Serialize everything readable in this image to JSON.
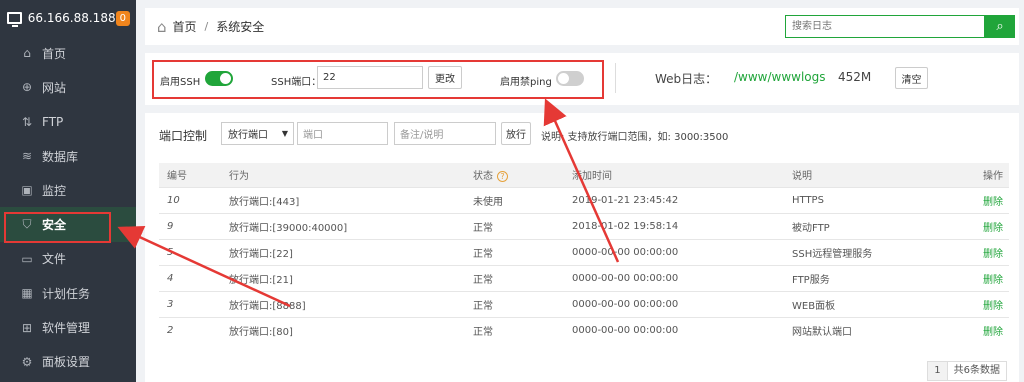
{
  "server": {
    "ip": "66.166.88.188",
    "badge": "0"
  },
  "sidebar": {
    "items": [
      {
        "label": "首页",
        "icon": "home-icon",
        "glyph": "⌂"
      },
      {
        "label": "网站",
        "icon": "globe-icon",
        "glyph": "⊕"
      },
      {
        "label": "FTP",
        "icon": "ftp-icon",
        "glyph": "⇅"
      },
      {
        "label": "数据库",
        "icon": "database-icon",
        "glyph": "≋"
      },
      {
        "label": "监控",
        "icon": "monitor-icon",
        "glyph": "▣"
      },
      {
        "label": "安全",
        "icon": "shield-icon",
        "glyph": "⛉"
      },
      {
        "label": "文件",
        "icon": "folder-icon",
        "glyph": "▭"
      },
      {
        "label": "计划任务",
        "icon": "calendar-icon",
        "glyph": "▦"
      },
      {
        "label": "软件管理",
        "icon": "apps-icon",
        "glyph": "⊞"
      },
      {
        "label": "面板设置",
        "icon": "gear-icon",
        "glyph": "⚙"
      }
    ],
    "active_index": 5
  },
  "breadcrumb": {
    "home": "首页",
    "separator": "/",
    "current": "系统安全"
  },
  "search": {
    "placeholder": "搜索日志",
    "icon": "search-icon"
  },
  "ssh": {
    "enable_label": "启用SSH",
    "enabled": true,
    "port_label": "SSH端口：",
    "port_value": "22",
    "change_button": "更改",
    "ping_label": "启用禁ping",
    "ping_enabled": false
  },
  "weblog": {
    "label": "Web日志：",
    "path": "/www/wwwlogs",
    "size": "452M",
    "clear_button": "清空"
  },
  "port_control": {
    "title": "端口控制",
    "action_select": "放行端口",
    "port_placeholder": "端口",
    "note_placeholder": "备注/说明",
    "submit_button": "放行",
    "hint": "说明: 支持放行端口范围，如: 3000:3500"
  },
  "table": {
    "headers": {
      "id": "编号",
      "action": "行为",
      "status": "状态",
      "time": "添加时间",
      "desc": "说明",
      "op": "操作"
    },
    "rows": [
      {
        "id": "10",
        "action": "放行端口:[443]",
        "status": "未使用",
        "time": "2019-01-21 23:45:42",
        "desc": "HTTPS",
        "op": "删除"
      },
      {
        "id": "9",
        "action": "放行端口:[39000:40000]",
        "status": "正常",
        "time": "2018-01-02 19:58:14",
        "desc": "被动FTP",
        "op": "删除"
      },
      {
        "id": "5",
        "action": "放行端口:[22]",
        "status": "正常",
        "time": "0000-00-00 00:00:00",
        "desc": "SSH远程管理服务",
        "op": "删除"
      },
      {
        "id": "4",
        "action": "放行端口:[21]",
        "status": "正常",
        "time": "0000-00-00 00:00:00",
        "desc": "FTP服务",
        "op": "删除"
      },
      {
        "id": "3",
        "action": "放行端口:[8888]",
        "status": "正常",
        "time": "0000-00-00 00:00:00",
        "desc": "WEB面板",
        "op": "删除"
      },
      {
        "id": "2",
        "action": "放行端口:[80]",
        "status": "正常",
        "time": "0000-00-00 00:00:00",
        "desc": "网站默认端口",
        "op": "删除"
      }
    ]
  },
  "pager": {
    "page": "1",
    "total": "共6条数据"
  },
  "colors": {
    "accent": "#20a53a",
    "sidebar": "#2f3640",
    "annotation": "#e53935"
  }
}
